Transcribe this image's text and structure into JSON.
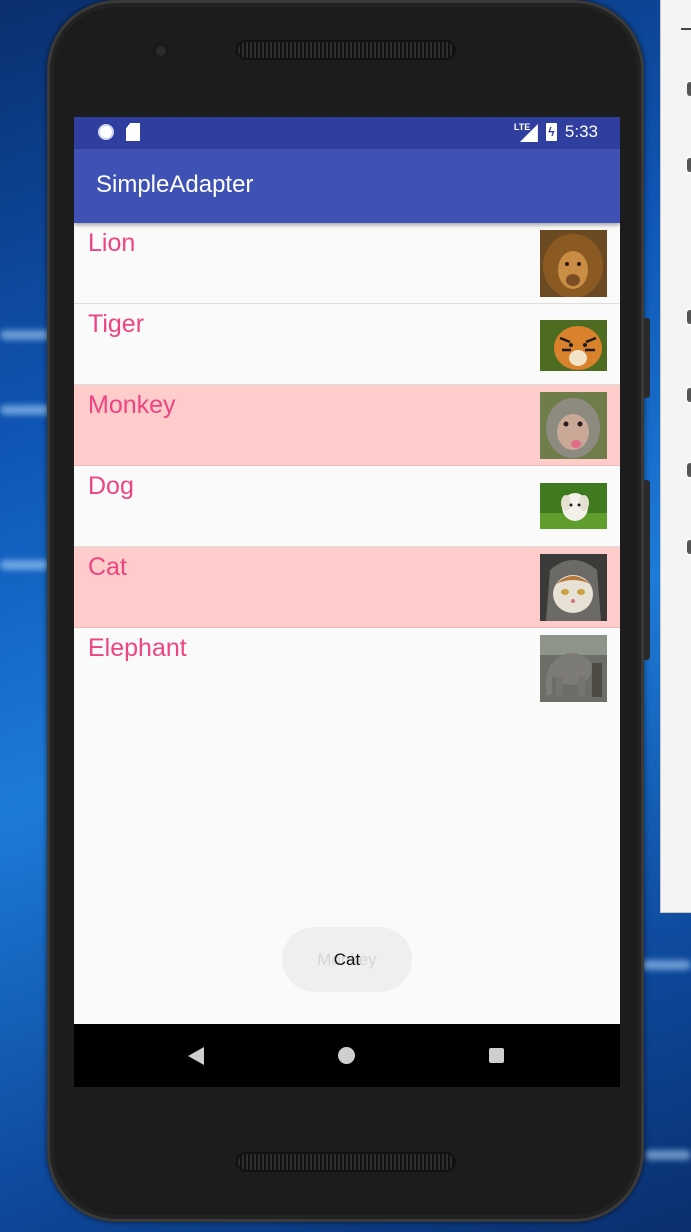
{
  "status_bar": {
    "time": "5:33",
    "network_label": "LTE"
  },
  "app_bar": {
    "title": "SimpleAdapter"
  },
  "list_items": [
    {
      "name": "Lion",
      "selected": false,
      "icon": "lion-image"
    },
    {
      "name": "Tiger",
      "selected": false,
      "icon": "tiger-image"
    },
    {
      "name": "Monkey",
      "selected": true,
      "icon": "monkey-image"
    },
    {
      "name": "Dog",
      "selected": false,
      "icon": "dog-image"
    },
    {
      "name": "Cat",
      "selected": true,
      "icon": "cat-image"
    },
    {
      "name": "Elephant",
      "selected": false,
      "icon": "elephant-image"
    }
  ],
  "toast": {
    "message": "Cat",
    "fading_message": "Monkey"
  },
  "colors": {
    "status_bar": "#303f9f",
    "app_bar": "#3f51b5",
    "item_text": "#ee4481",
    "selected_row": "#ffcccc",
    "screen_background": "#fafafa"
  }
}
